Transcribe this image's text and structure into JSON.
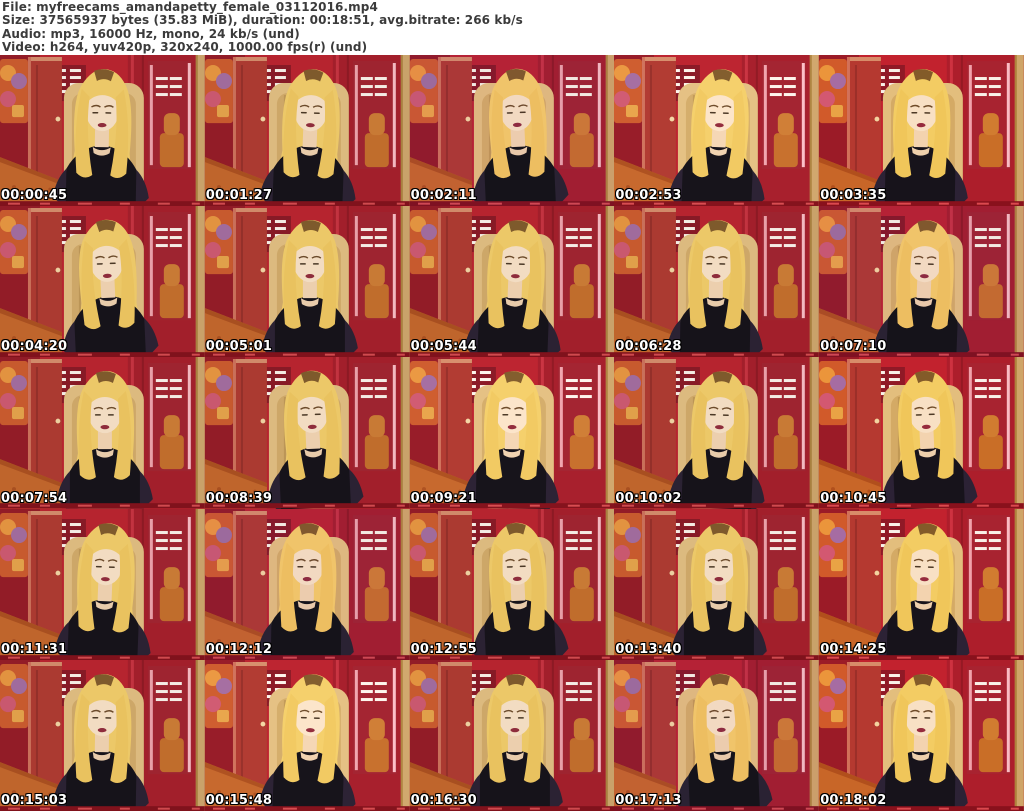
{
  "header": {
    "lines": [
      "File: myfreecams_amandapetty_female_03112016.mp4",
      "Size: 37565937 bytes (35.83 MiB), duration: 00:18:51, avg.bitrate: 266 kb/s",
      "Audio: mp3, 16000 Hz, mono, 24 kb/s (und)",
      "Video: h264, yuv420p, 320x240, 1000.00 fps(r) (und)"
    ]
  },
  "grid": {
    "rows": 5,
    "columns": 5,
    "timestamps": [
      "00:00:45",
      "00:01:27",
      "00:02:11",
      "00:02:53",
      "00:03:35",
      "00:04:20",
      "00:05:01",
      "00:05:44",
      "00:06:28",
      "00:07:10",
      "00:07:54",
      "00:08:39",
      "00:09:21",
      "00:10:02",
      "00:10:45",
      "00:11:31",
      "00:12:12",
      "00:12:55",
      "00:13:40",
      "00:14:25",
      "00:15:03",
      "00:15:48",
      "00:16:30",
      "00:17:13",
      "00:18:02"
    ]
  },
  "palette": {
    "wall_red": "#b6242f",
    "wall_dark_red": "#921c27",
    "floor_orange": "#bf652c",
    "chair_tan": "#dcba7f",
    "hair_blonde": "#ecc868",
    "top_black": "#16131a",
    "neon_pink": "#ff9fb4",
    "neon_white": "#f4ece4",
    "banner_red": "#80121c",
    "timestamp_text": "#ffffff",
    "timestamp_outline": "#000000",
    "header_text": "#3b3b3b",
    "header_background": "#ffffff"
  }
}
